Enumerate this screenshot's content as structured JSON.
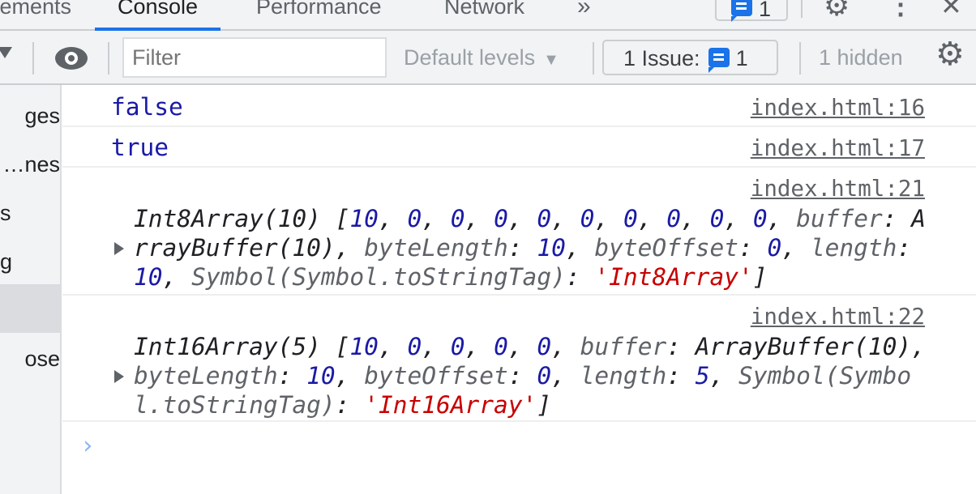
{
  "tabs": [
    {
      "label": "Elements",
      "text": "ements"
    },
    {
      "label": "Console"
    },
    {
      "label": "Performance"
    },
    {
      "label": "Network"
    }
  ],
  "more_tabs": "»",
  "issues_badge_count": "1",
  "toolbar": {
    "filter_placeholder": "Filter",
    "levels": "Default levels",
    "issues_label": "1 Issue:",
    "issues_count": "1",
    "hidden": "1 hidden"
  },
  "sidebar": {
    "items": [
      {
        "label": "ges"
      },
      {
        "label": "nes…"
      },
      {
        "label": "s"
      },
      {
        "label": "g"
      },
      {
        "label": ""
      },
      {
        "label": "ose"
      }
    ],
    "selected_index": 4
  },
  "messages": [
    {
      "value": "false",
      "source": "index.html:16"
    },
    {
      "value": "true",
      "source": "index.html:17"
    },
    {
      "source": "index.html:21",
      "lines": [
        [
          [
            "Int8Array(10) [",
            "obj"
          ],
          [
            "10",
            "num"
          ],
          [
            ", ",
            "obj"
          ],
          [
            "0",
            "num"
          ],
          [
            ", ",
            "obj"
          ],
          [
            "0",
            "num"
          ],
          [
            ", ",
            "obj"
          ],
          [
            "0",
            "num"
          ],
          [
            ", ",
            "obj"
          ],
          [
            "0",
            "num"
          ],
          [
            ", ",
            "obj"
          ],
          [
            "0",
            "num"
          ],
          [
            ", ",
            "obj"
          ],
          [
            "0",
            "num"
          ],
          [
            ", ",
            "obj"
          ],
          [
            "0",
            "num"
          ],
          [
            ", ",
            "obj"
          ],
          [
            "0",
            "num"
          ],
          [
            ", ",
            "obj"
          ],
          [
            "0",
            "num"
          ],
          [
            ", ",
            "obj"
          ],
          [
            "buffer",
            "key"
          ],
          [
            ": A",
            "obj"
          ]
        ],
        [
          [
            "rrayBuffer(10)",
            "obj"
          ],
          [
            ", ",
            "obj"
          ],
          [
            "byteLength",
            "key"
          ],
          [
            ": ",
            "obj"
          ],
          [
            "10",
            "num"
          ],
          [
            ", ",
            "obj"
          ],
          [
            "byteOffset",
            "key"
          ],
          [
            ": ",
            "obj"
          ],
          [
            "0",
            "num"
          ],
          [
            ", ",
            "obj"
          ],
          [
            "length",
            "key"
          ],
          [
            ":",
            "obj"
          ]
        ],
        [
          [
            "10",
            "num"
          ],
          [
            ", ",
            "obj"
          ],
          [
            "Symbol(Symbol.toStringTag)",
            "key"
          ],
          [
            ": ",
            "obj"
          ],
          [
            "'Int8Array'",
            "str"
          ],
          [
            "]",
            "obj"
          ]
        ]
      ]
    },
    {
      "source": "index.html:22",
      "lines": [
        [
          [
            "Int16Array(5) [",
            "obj"
          ],
          [
            "10",
            "num"
          ],
          [
            ", ",
            "obj"
          ],
          [
            "0",
            "num"
          ],
          [
            ", ",
            "obj"
          ],
          [
            "0",
            "num"
          ],
          [
            ", ",
            "obj"
          ],
          [
            "0",
            "num"
          ],
          [
            ", ",
            "obj"
          ],
          [
            "0",
            "num"
          ],
          [
            ", ",
            "obj"
          ],
          [
            "buffer",
            "key"
          ],
          [
            ": ArrayBuffer(10),",
            "obj"
          ]
        ],
        [
          [
            "byteLength",
            "key"
          ],
          [
            ": ",
            "obj"
          ],
          [
            "10",
            "num"
          ],
          [
            ", ",
            "obj"
          ],
          [
            "byteOffset",
            "key"
          ],
          [
            ": ",
            "obj"
          ],
          [
            "0",
            "num"
          ],
          [
            ", ",
            "obj"
          ],
          [
            "length",
            "key"
          ],
          [
            ": ",
            "obj"
          ],
          [
            "5",
            "num"
          ],
          [
            ", ",
            "obj"
          ],
          [
            "Symbol(Symbo",
            "key"
          ]
        ],
        [
          [
            "l.toStringTag)",
            "key"
          ],
          [
            ": ",
            "obj"
          ],
          [
            "'Int16Array'",
            "str"
          ],
          [
            "]",
            "obj"
          ]
        ]
      ]
    }
  ],
  "prompt": "›",
  "colors": {
    "accent": "#1a73e8",
    "number": "#1a1aa6",
    "string": "#c80000",
    "key": "#5f6368"
  },
  "icons": [
    "more-tabs-icon",
    "issues-icon",
    "gear-icon",
    "kebab-menu-icon",
    "close-icon",
    "dropdown-icon",
    "eye-icon",
    "expand-triangle-icon"
  ]
}
